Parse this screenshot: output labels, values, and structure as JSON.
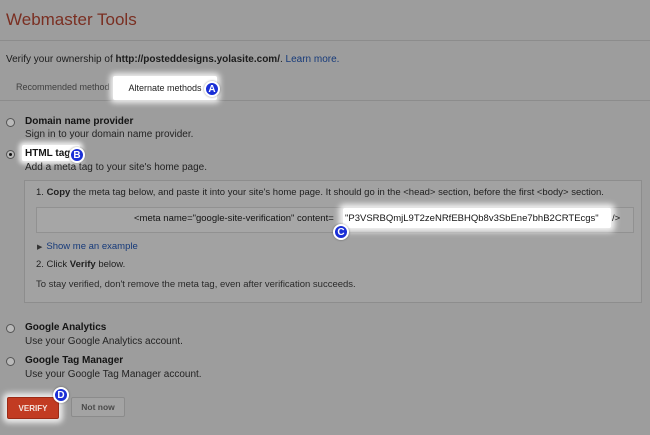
{
  "header": {
    "title": "Webmaster Tools"
  },
  "intro": {
    "prefix": "Verify your ownership of ",
    "url": "http://posteddesigns.yolasite.com/",
    "suffix": ". ",
    "learn_more": "Learn more."
  },
  "tabs": [
    {
      "label": "Recommended method",
      "active": false
    },
    {
      "label": "Alternate methods",
      "active": true
    }
  ],
  "options": {
    "domain": {
      "title": "Domain name provider",
      "desc": "Sign in to your domain name provider."
    },
    "html_tag": {
      "title": "HTML tag",
      "desc": "Add a meta tag to your site's home page.",
      "selected": true
    },
    "analytics": {
      "title": "Google Analytics",
      "desc": "Use your Google Analytics account."
    },
    "tag_manager": {
      "title": "Google Tag Manager",
      "desc": "Use your Google Tag Manager account."
    }
  },
  "instructions": {
    "step1_num": "1. ",
    "step1_bold": "Copy",
    "step1_rest": " the meta tag below, and paste it into your site's home page. It should go in the <head> section, before the first <body> section.",
    "meta_prefix": "<meta name=\"google-site-verification\" content=",
    "meta_value": "\"P3VSRBQmjL9T2zeNRfEBHQb8v3SbEne7bhB2CRTEcgs\"",
    "meta_suffix": " />",
    "show_example": "Show me an example",
    "step2_prefix": "2. Click ",
    "step2_bold": "Verify",
    "step2_suffix": " below.",
    "stay_verified": "To stay verified, don't remove the meta tag, even after verification succeeds."
  },
  "buttons": {
    "verify": "VERIFY",
    "not_now": "Not now"
  },
  "badges": {
    "a": "A",
    "b": "B",
    "c": "C",
    "d": "D"
  },
  "colors": {
    "accent": "#c23b22",
    "link": "#163a7a",
    "badge": "#1a2fd6"
  }
}
